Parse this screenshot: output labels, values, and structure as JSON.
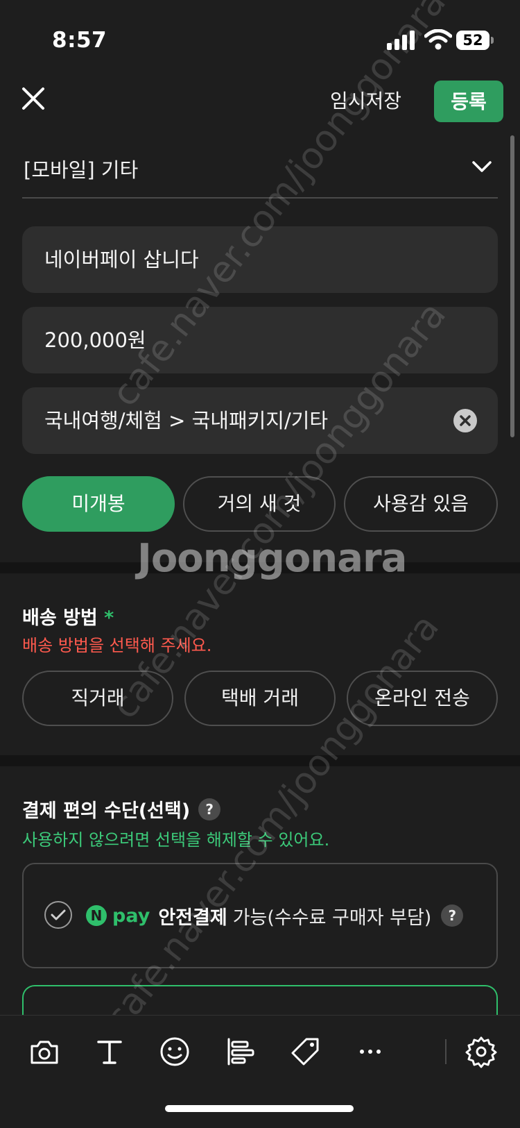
{
  "status_bar": {
    "time": "8:57",
    "battery": "52"
  },
  "header": {
    "temp_save_label": "임시저장",
    "register_label": "등록"
  },
  "category": {
    "value": "[모바일] 기타"
  },
  "fields": {
    "title": "네이버페이 삽니다",
    "price": "200,000원",
    "sub_category": "국내여행/체험 > 국내패키지/기타"
  },
  "condition_options": [
    {
      "label": "미개봉",
      "selected": true
    },
    {
      "label": "거의 새 것",
      "selected": false
    },
    {
      "label": "사용감 있음",
      "selected": false
    }
  ],
  "shipping": {
    "title": "배송 방법",
    "required_mark": "*",
    "error": "배송 방법을 선택해 주세요.",
    "options": [
      "직거래",
      "택배 거래",
      "온라인 전송"
    ]
  },
  "payment": {
    "title": "결제 편의 수단(선택)",
    "hint": "사용하지 않으려면 선택을 해제할 수 있어요.",
    "npay_n": "N",
    "npay_word": "pay",
    "strong_label": "안전결제",
    "rest_label": "가능(수수료 구매자 부담)"
  },
  "watermark": {
    "brand": "Joonggonara",
    "url": "cafe.naver.com/joonggonara"
  },
  "colors": {
    "accent": "#2f9d5f",
    "error": "#ff5a4e",
    "hint": "#3ccb7a",
    "background": "#1e1e1e"
  }
}
